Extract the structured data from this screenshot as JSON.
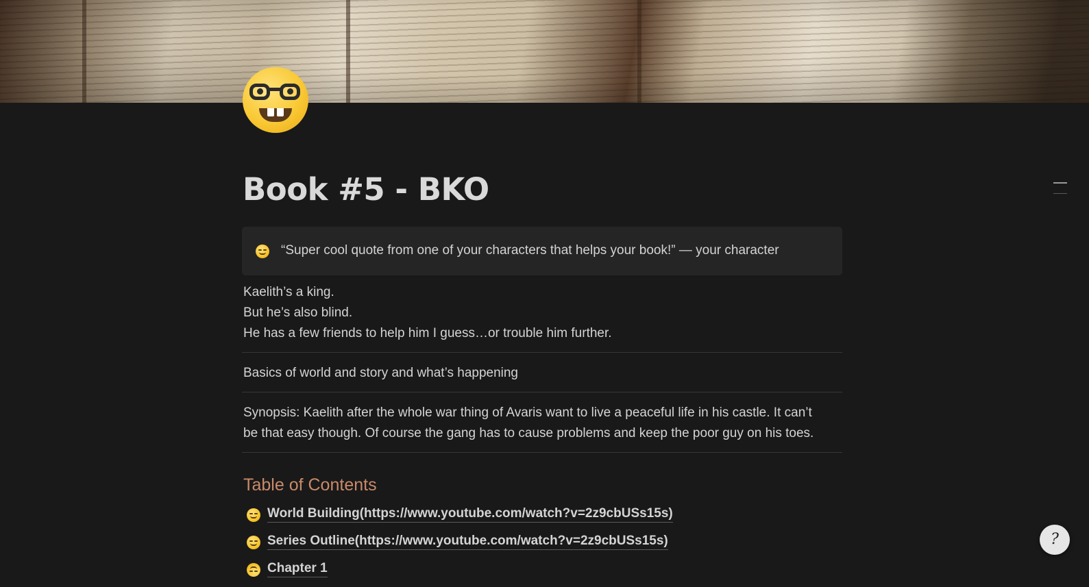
{
  "page": {
    "title": "Book #5 - BKO",
    "icon": "nerd-face-icon",
    "cover": "old-books-cover-image"
  },
  "callout": {
    "icon": "smirking-face-icon",
    "text": "“Super cool quote from one of your characters that helps your book!” — your character"
  },
  "intro_lines": [
    "Kaelith’s a king.",
    "But he’s also blind.",
    "He has a few friends to help him I guess…or trouble him further."
  ],
  "basics": "Basics of world and story and what’s happening",
  "synopsis": [
    "Synopsis: Kaelith after the whole war thing of Avaris want to live a peaceful life in his castle. It can’t",
    "be that easy though. Of course the gang has to cause problems and keep the poor guy on his toes."
  ],
  "toc": {
    "heading": "Table of Contents",
    "heading_color": "#c98a6a",
    "items": [
      {
        "icon": "smirking-face-icon",
        "label": "World Building(https://www.youtube.com/watch?v=2z9cbUSs15s)"
      },
      {
        "icon": "thinking-face-icon",
        "label": "Series Outline(https://www.youtube.com/watch?v=2z9cbUSs15s)"
      },
      {
        "icon": "upside-down-face-icon",
        "label": "Chapter 1"
      }
    ]
  },
  "help": {
    "icon": "help-icon",
    "glyph": "?"
  },
  "colors": {
    "background": "#191919",
    "callout_background": "#252525",
    "text": "#d4d4d4"
  }
}
